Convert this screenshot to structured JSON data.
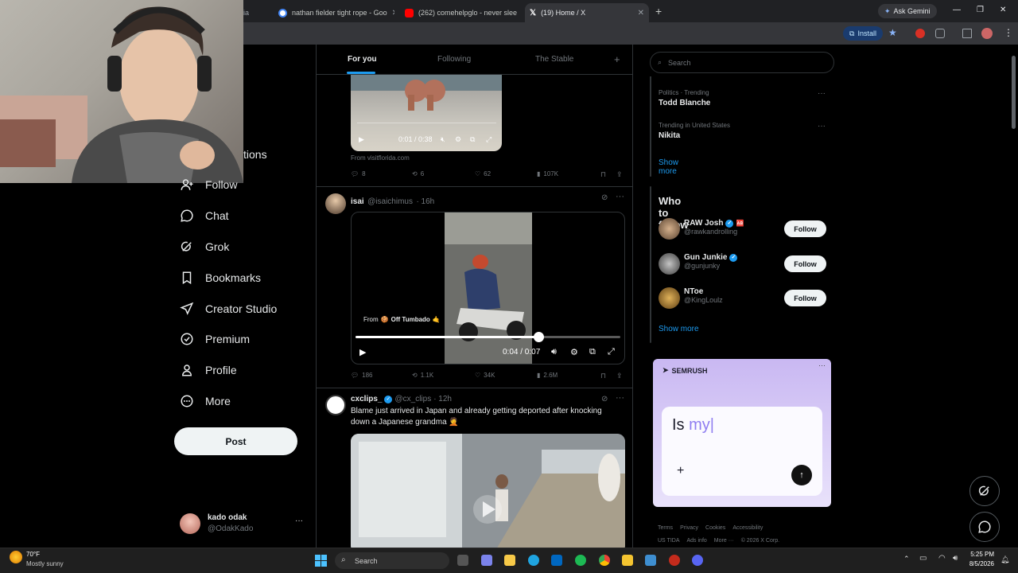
{
  "browser": {
    "tabs": [
      {
        "label": "nathan fielder tight rope - Goo"
      },
      {
        "label": "(262) comehelpglo - never slee"
      },
      {
        "label": "(19) Home / X"
      }
    ],
    "partial_tab": "ia",
    "new_tab": "+",
    "ask_gemini": "Ask Gemini",
    "install": "Install",
    "win_min": "—",
    "win_max": "❐",
    "win_close": "✕"
  },
  "sidebar": {
    "partial_item": "tions",
    "items": [
      {
        "label": "Follow",
        "icon": "person-plus-icon"
      },
      {
        "label": "Chat",
        "icon": "chat-bubble-icon"
      },
      {
        "label": "Grok",
        "icon": "grok-icon"
      },
      {
        "label": "Bookmarks",
        "icon": "bookmark-icon"
      },
      {
        "label": "Creator Studio",
        "icon": "rocket-icon"
      },
      {
        "label": "Premium",
        "icon": "verified-icon"
      },
      {
        "label": "Profile",
        "icon": "person-icon"
      },
      {
        "label": "More",
        "icon": "more-circle-icon"
      }
    ],
    "post_label": "Post",
    "account": {
      "name": "kado odak",
      "handle": "@OdakKado",
      "more": "···"
    }
  },
  "feed": {
    "tabs": [
      {
        "label": "For you"
      },
      {
        "label": "Following"
      },
      {
        "label": "The Stable"
      }
    ],
    "add_tab": "+",
    "post1": {
      "video_time": "0:01 / 0:38",
      "source": "From visitflorida.com",
      "replies": "8",
      "reposts": "6",
      "likes": "62",
      "views": "107K"
    },
    "post2": {
      "name": "isai",
      "handle": "@isaichimus",
      "time": "· 16h",
      "from_label": "From",
      "from_name": "Off Tumbado",
      "video_time": "0:04 / 0:07",
      "progress": 0.69,
      "replies": "186",
      "reposts": "1.1K",
      "likes": "34K",
      "views": "2.6M"
    },
    "post3": {
      "name": "cxclips_",
      "handle": "@cx_clips",
      "time": "· 12h",
      "text": "Blame just arrived in Japan and already getting deported after knocking down a Japanese grandma 🤦"
    }
  },
  "right": {
    "search_placeholder": "Search",
    "trends": [
      {
        "meta": "Politics · Trending",
        "name": "Todd Blanche"
      },
      {
        "meta": "Trending in United States",
        "name": "Nikita"
      }
    ],
    "show_more": "Show more",
    "who_title": "Who to follow",
    "who": [
      {
        "name": "RAW Josh",
        "handle": "@rawkandrolling",
        "button": "Follow"
      },
      {
        "name": "Gun Junkie",
        "handle": "@gunjunky",
        "button": "Follow"
      },
      {
        "name": "NToe",
        "handle": "@KingLoulz",
        "button": "Follow"
      }
    ],
    "who_show_more": "Show more",
    "ad": {
      "brand": "SEMRUSH",
      "typed_dark": "Is",
      "typed_accent": "my",
      "plus": "+"
    },
    "footer": {
      "line1": [
        "Terms",
        "Privacy",
        "Cookies",
        "Accessibility"
      ],
      "line2": [
        "US TIDA",
        "Ads info",
        "More ···",
        "© 2026 X Corp."
      ]
    }
  },
  "taskbar": {
    "temp": "70°F",
    "weather": "Mostly sunny",
    "search": "Search",
    "time": "5:25 PM",
    "date": "8/5/2026"
  },
  "colors": {
    "accent": "#1d9bf0",
    "border": "#2f3336",
    "muted": "#71767b",
    "verified": "#1d9bf0"
  }
}
